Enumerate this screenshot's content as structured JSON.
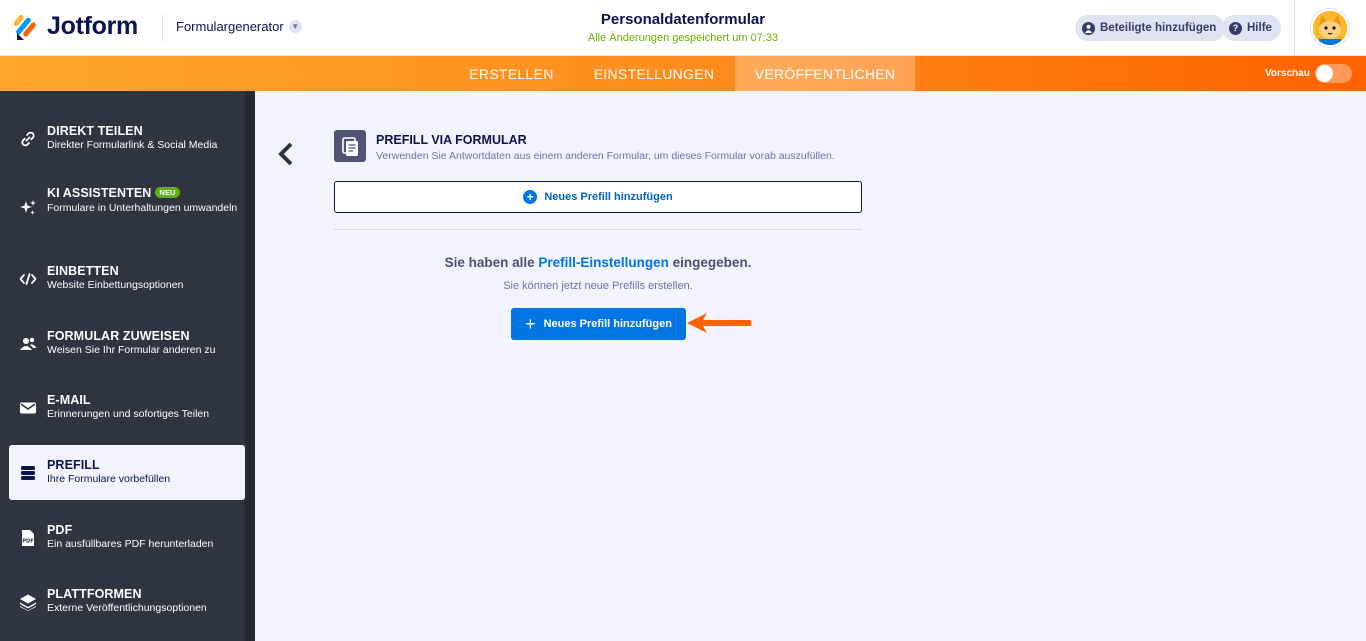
{
  "header": {
    "logo_text": "Jotform",
    "generator_label": "Formulargenerator",
    "form_title": "Personaldatenformular",
    "save_status": "Alle Änderungen gespeichert um 07:33",
    "invite_label": "Beteiligte hinzufügen",
    "help_label": "Hilfe"
  },
  "nav": {
    "tabs": [
      {
        "label": "ERSTELLEN",
        "active": false
      },
      {
        "label": "EINSTELLUNGEN",
        "active": false
      },
      {
        "label": "VERÖFFENTLICHEN",
        "active": true
      }
    ],
    "preview_label": "Vorschau",
    "preview_on": false
  },
  "sidebar": {
    "items": [
      {
        "title": "DIREKT TEILEN",
        "subtitle": "Direkter Formularlink & Social Media",
        "icon": "link-icon"
      },
      {
        "title": "KI ASSISTENTEN",
        "badge": "NEU",
        "subtitle": "Formulare in Unterhaltungen umwandeln",
        "icon": "sparkle-icon"
      },
      {
        "title": "EINBETTEN",
        "subtitle": "Website Einbettungsoptionen",
        "icon": "code-icon"
      },
      {
        "title": "FORMULAR ZUWEISEN",
        "subtitle": "Weisen Sie Ihr Formular anderen zu",
        "icon": "users-icon"
      },
      {
        "title": "E-MAIL",
        "subtitle": "Erinnerungen und sofortiges Teilen",
        "icon": "envelope-icon"
      },
      {
        "title": "PREFILL",
        "subtitle": "Ihre Formulare vorbefüllen",
        "icon": "database-icon",
        "active": true
      },
      {
        "title": "PDF",
        "subtitle": "Ein ausfüllbares PDF herunterladen",
        "icon": "pdf-icon"
      },
      {
        "title": "PLATTFORMEN",
        "subtitle": "Externe Veröffentlichungsoptionen",
        "icon": "layers-icon"
      }
    ]
  },
  "main": {
    "section_title": "PREFILL VIA FORMULAR",
    "section_desc": "Verwenden Sie Antwortdaten aus einem anderen Formular, um dieses Formular vorab auszufüllen.",
    "add_outline_label": "Neues Prefill hinzufügen",
    "done_prefix": "Sie haben alle",
    "done_link": "Prefill-Einstellungen",
    "done_suffix": "eingegeben.",
    "sub_text": "Sie können jetzt neue Prefills erstellen.",
    "add_solid_label": "Neues Prefill hinzufügen"
  },
  "colors": {
    "accent_blue": "#0075e3",
    "navbar_orange": "#ff8a1c",
    "sidebar_bg": "#2f3441",
    "success_green": "#64b200",
    "annotation_arrow": "#ff6100"
  }
}
